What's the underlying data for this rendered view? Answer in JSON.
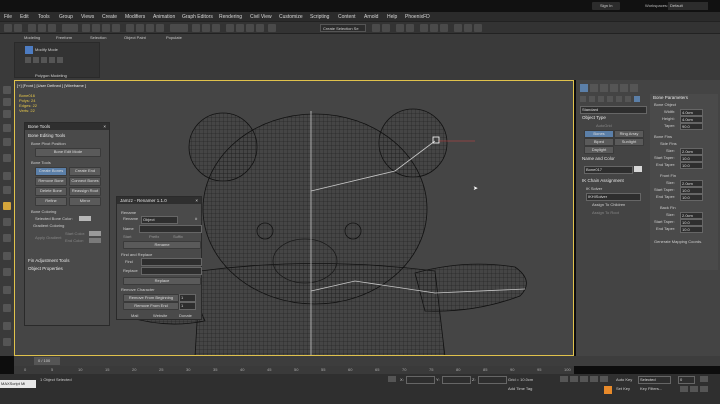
{
  "window": {
    "title_right": "Sign In",
    "workspace_label": "Workspaces:",
    "workspace_value": "Default"
  },
  "menu": [
    "File",
    "Edit",
    "Tools",
    "Group",
    "Views",
    "Create",
    "Modifiers",
    "Animation",
    "Graph Editors",
    "Rendering",
    "Civil View",
    "Customize",
    "Scripting",
    "Content",
    "Arnold",
    "Help",
    "PhoenixFD"
  ],
  "toolbar": {
    "selection_set": "Create Selection Se"
  },
  "ribbon": {
    "tabs": [
      "Modeling",
      "Freeform",
      "Selection",
      "Object Paint",
      "Populate"
    ],
    "modify_mode": "Modify Mode",
    "group_label": "Polygon Modeling"
  },
  "viewport": {
    "label": "[+] [Front ] [User Defined ] [Wireframe ]",
    "stats": {
      "name": "Bone016",
      "polys_label": "Polys:",
      "polys": "24",
      "edges_label": "Edges:",
      "edges": "22",
      "verts_label": "Verts:",
      "verts": "22"
    }
  },
  "bone_tools": {
    "title": "Bone Tools",
    "editing_section": "Bone Editing Tools",
    "pivot_label": "Bone Pivot Position",
    "edit_mode": "Bone Edit Mode",
    "tools_label": "Bone Tools",
    "buttons": [
      "Create Bones",
      "Create End",
      "Remove Bone",
      "Connect Bones",
      "Delete Bone",
      "Reassign Root",
      "Refine",
      "Mirror"
    ],
    "coloring": "Bone Coloring",
    "selected_color": "Selected Bone Color:",
    "gradient": "Gradient Coloring",
    "apply_gradient": "Apply Gradient",
    "start_color": "Start Color:",
    "end_color": "End Color:",
    "fin_section": "Fin Adjustment Tools",
    "props_section": "Object Properties"
  },
  "renamer": {
    "title": "Jamzz - Renamer 1.1.0",
    "rename_label": "Rename",
    "rename_sub": "Rename",
    "object_dropdown": "Object",
    "name_label": "Name",
    "num_label": "#",
    "start_label": "Start",
    "prefix_label": "Prefix",
    "suffix_label": "Suffix",
    "rename_btn": "Rename",
    "find_section": "Find and Replace",
    "find_label": "Find",
    "replace_label": "Replace",
    "replace_btn": "Replace",
    "remove_section": "Remove Character",
    "remove_from_beginning": "Remove From Beginning",
    "remove_from_end": "Remove From End",
    "v1": "1",
    "v2": "1",
    "footer": [
      "Mail",
      "Website",
      "Donate"
    ]
  },
  "command_panel": {
    "dropdown": "Standard",
    "object_type": "Object Type",
    "autogrid": "AutoGrid",
    "types": [
      "Bones",
      "Ring Array",
      "Biped",
      "Sunlight",
      "Daylight"
    ],
    "name_color": "Name and Color",
    "name_value": "Bone017",
    "ik_section": "IK Chain Assignment",
    "ik_solver": "IK Solver",
    "ik_value": "IKHISolver",
    "assign_children": "Assign To Children",
    "assign_root": "Assign To Root"
  },
  "bone_params": {
    "title": "Bone Parameters",
    "object_label": "Bone Object",
    "width_label": "Width:",
    "width": "4.0cm",
    "height_label": "Height:",
    "height": "4.0cm",
    "taper_label": "Taper:",
    "taper": "90.0",
    "fins_label": "Bone Fins",
    "side_fins": "Side Fins",
    "size_label": "Size:",
    "size": "2.0cm",
    "start_taper_label": "Start Taper:",
    "start_taper": "10.0",
    "end_taper_label": "End Taper:",
    "end_taper": "10.0",
    "front_fin": "Front Fin",
    "back_fin": "Back Fin",
    "gen_mapping": "Generate Mapping Coords."
  },
  "timeline": {
    "frame": "0 / 100",
    "ticks": [
      "0",
      "5",
      "10",
      "15",
      "20",
      "25",
      "30",
      "35",
      "40",
      "45",
      "50",
      "55",
      "60",
      "65",
      "70",
      "75",
      "80",
      "85",
      "90",
      "95",
      "100"
    ]
  },
  "status": {
    "maxscript": "MAXScript Mi",
    "selected": "1 Object Selected",
    "x_label": "X:",
    "y_label": "Y:",
    "z_label": "Z:",
    "grid": "Grid = 10.0cm",
    "add_time_tag": "Add Time Tag",
    "auto_key": "Auto Key",
    "set_key": "Set Key",
    "selected_dd": "Selected",
    "key_filters": "Key Filters...",
    "frame": "0"
  },
  "colors": {
    "accent": "#5b7fa8",
    "viewport": "#454545",
    "orange": "#e88a2a",
    "active_border": "#e0c24c"
  }
}
